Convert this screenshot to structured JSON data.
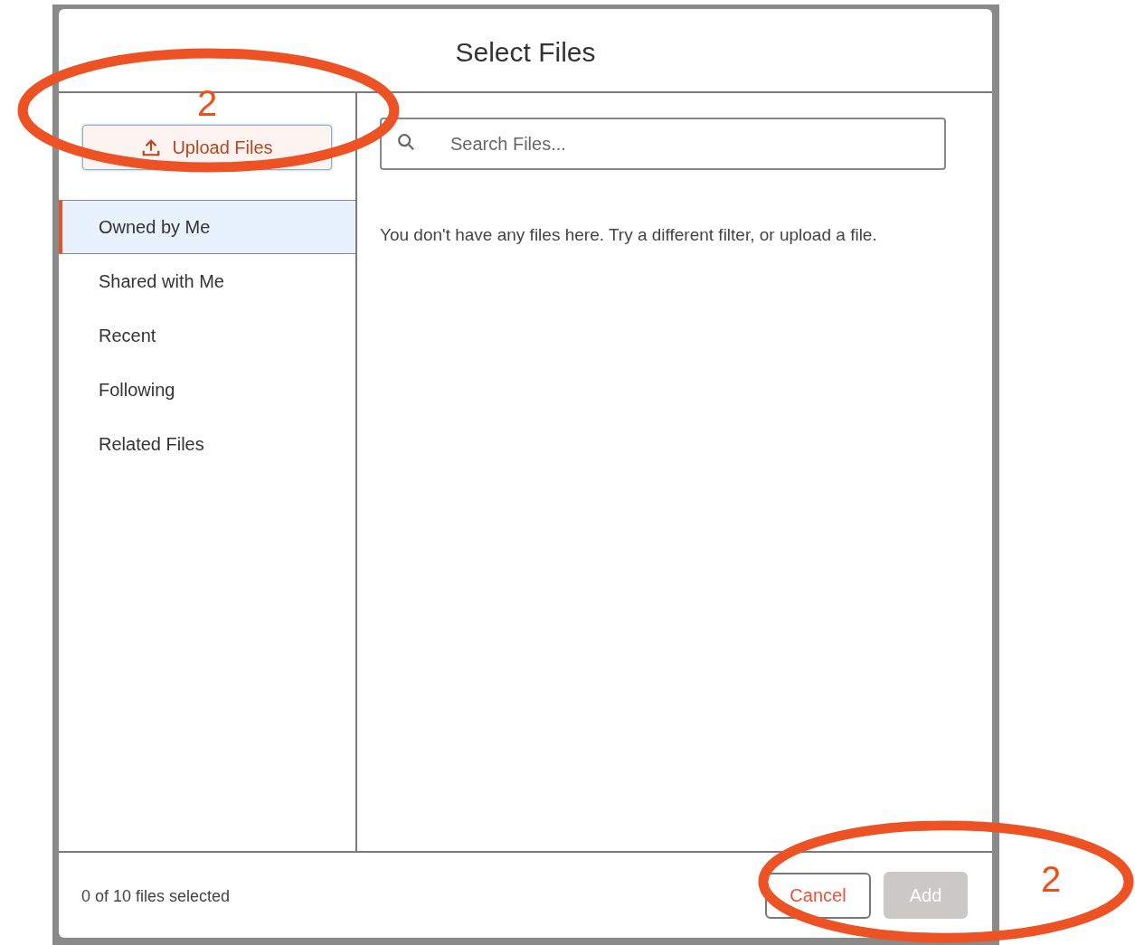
{
  "dialog": {
    "title": "Select Files",
    "upload_button": {
      "label": "Upload Files"
    },
    "search": {
      "placeholder": "Search Files..."
    },
    "filters": [
      {
        "label": "Owned by Me",
        "selected": true
      },
      {
        "label": "Shared with Me",
        "selected": false
      },
      {
        "label": "Recent",
        "selected": false
      },
      {
        "label": "Following",
        "selected": false
      },
      {
        "label": "Related Files",
        "selected": false
      }
    ],
    "empty_message": "You don't have any files here. Try a different filter, or upload a file.",
    "footer": {
      "status": "0 of 10 files selected",
      "buttons": [
        {
          "label": "Cancel",
          "kind": "secondary",
          "disabled": false
        },
        {
          "label": "Add",
          "kind": "primary",
          "disabled": true
        }
      ]
    }
  },
  "annotations": [
    {
      "label": "2"
    },
    {
      "label": "2"
    }
  ]
}
